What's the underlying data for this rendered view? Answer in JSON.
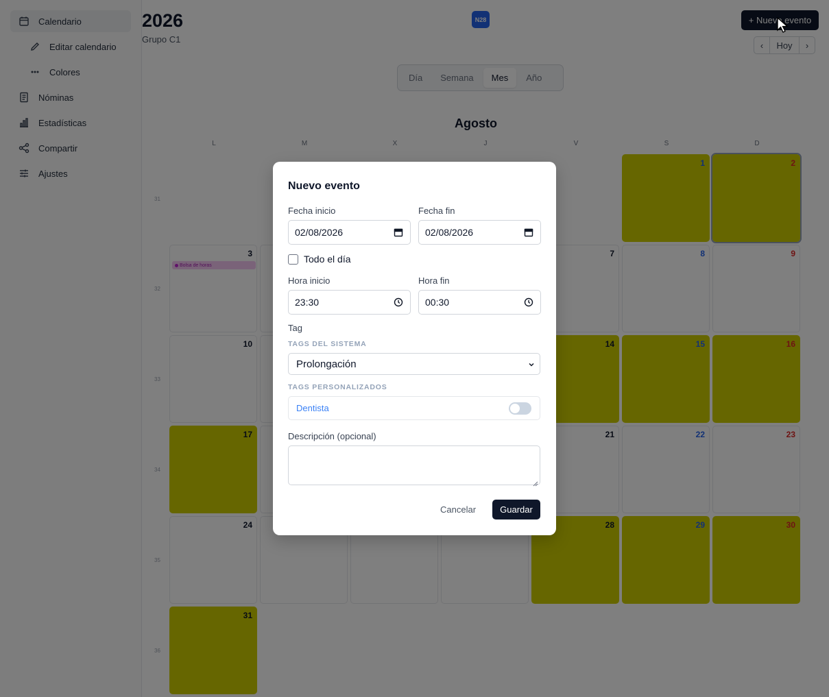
{
  "sidebar": {
    "items": [
      {
        "label": "Calendario",
        "icon": "calendar-icon"
      },
      {
        "label": "Editar calendario",
        "icon": "pencil-icon"
      },
      {
        "label": "Colores",
        "icon": "dots-icon"
      },
      {
        "label": "Nóminas",
        "icon": "document-icon"
      },
      {
        "label": "Estadísticas",
        "icon": "bar-chart-icon"
      },
      {
        "label": "Compartir",
        "icon": "share-icon"
      },
      {
        "label": "Ajustes",
        "icon": "sliders-icon"
      }
    ]
  },
  "header": {
    "year": "2026",
    "group": "Grupo C1",
    "badge": "N28",
    "new_event_label": "+ Nuevo evento",
    "prev": "‹",
    "today": "Hoy",
    "next": "›"
  },
  "views": [
    "Día",
    "Semana",
    "Mes",
    "Año"
  ],
  "calendar": {
    "month": "Agosto",
    "weekdays": [
      "L",
      "M",
      "X",
      "J",
      "V",
      "S",
      "D"
    ],
    "weeks": [
      "31",
      "32",
      "33",
      "34",
      "35",
      "36"
    ],
    "days": [
      "1",
      "2",
      "3",
      "7",
      "8",
      "9",
      "10",
      "14",
      "15",
      "16",
      "17",
      "21",
      "22",
      "23",
      "24",
      "28",
      "29",
      "30",
      "31"
    ],
    "event_chip": "Bolsa de horas",
    "highlight_color": "#cccc00"
  },
  "modal": {
    "title": "Nuevo evento",
    "start_date_label": "Fecha inicio",
    "start_date_value": "02/08/2026",
    "end_date_label": "Fecha fin",
    "end_date_value": "02/08/2026",
    "all_day_label": "Todo el día",
    "start_time_label": "Hora inicio",
    "start_time_value": "23:30",
    "end_time_label": "Hora fin",
    "end_time_value": "00:30",
    "tag_label": "Tag",
    "system_tags_label": "TAGS DEL SISTEMA",
    "system_tag_selected": "Prolongación",
    "custom_tags_label": "TAGS PERSONALIZADOS",
    "custom_tag": "Dentista",
    "description_label": "Descripción (opcional)",
    "cancel_label": "Cancelar",
    "save_label": "Guardar"
  }
}
